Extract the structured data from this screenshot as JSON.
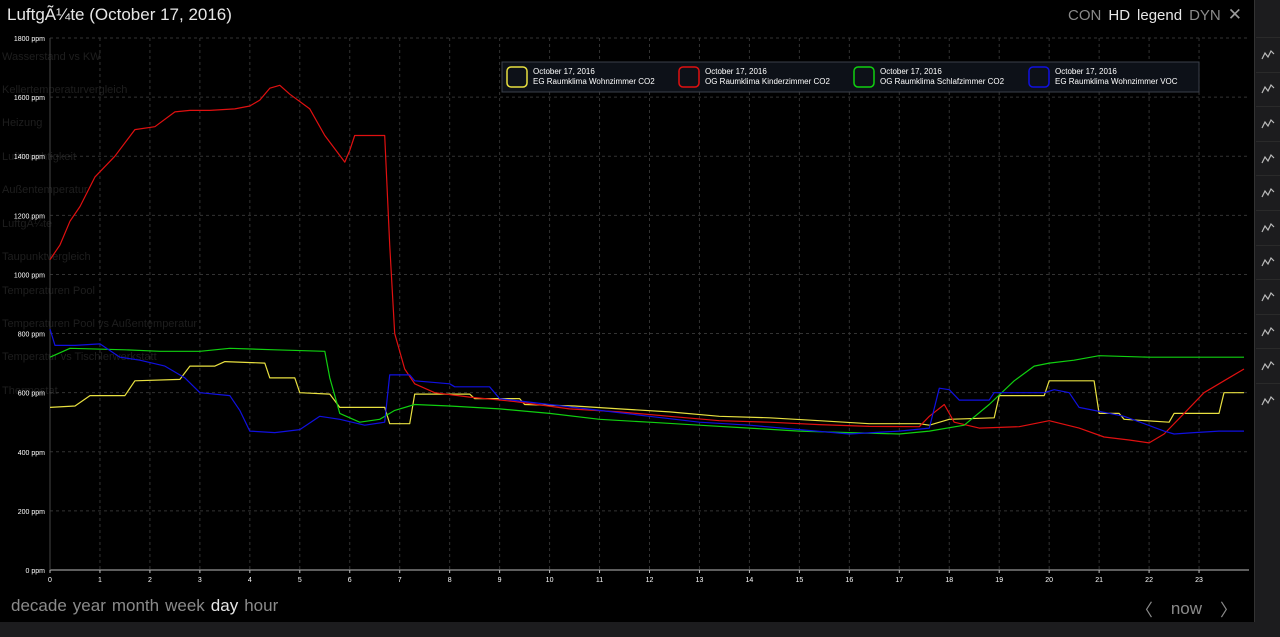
{
  "window": {
    "title": "LuftgÃ¼te (October 17, 2016)"
  },
  "toolbar": {
    "items": [
      {
        "label": "CON",
        "active": false
      },
      {
        "label": "HD",
        "active": true
      },
      {
        "label": "legend",
        "active": true
      },
      {
        "label": "DYN",
        "active": false
      }
    ],
    "close_label": "✕"
  },
  "ranges": {
    "items": [
      {
        "label": "decade",
        "active": false
      },
      {
        "label": "year",
        "active": false
      },
      {
        "label": "month",
        "active": false
      },
      {
        "label": "week",
        "active": false
      },
      {
        "label": "day",
        "active": true
      },
      {
        "label": "hour",
        "active": false
      }
    ]
  },
  "nav": {
    "prev": "〈",
    "now": "now",
    "next": "〉"
  },
  "background_list": [
    "Wasserstand vs KW",
    "Kellertemperaturvergleich",
    "Heizung",
    "Luftfeuchtigkeit",
    "Außentemperatur",
    "LuftgÃ¼te",
    "Taupunktvergleich",
    "Temperaturen Pool",
    "Temperaturen Pool vs Außentemperatur",
    "Temperatur vs Tischlerwerkstatt",
    "Thermostat"
  ],
  "side_icons": [
    "chart-icon",
    "chart-icon",
    "chart-icon",
    "chart-icon",
    "chart-icon",
    "chart-icon",
    "chart-icon",
    "chart-icon",
    "chart-icon",
    "chart-icon",
    "chart-icon"
  ],
  "colors": {
    "background": "#000000",
    "grid": "#333333",
    "axis_text": "#ffffff",
    "yellow": "#e8e040",
    "red": "#e01010",
    "green": "#10d010",
    "blue": "#1010e0"
  },
  "chart_data": {
    "type": "line",
    "xlabel": "",
    "ylabel": "",
    "xlim": [
      0,
      24
    ],
    "ylim": [
      0,
      1800
    ],
    "x_ticks": [
      0,
      1,
      2,
      3,
      4,
      5,
      6,
      7,
      8,
      9,
      10,
      11,
      12,
      13,
      14,
      15,
      16,
      17,
      18,
      19,
      20,
      21,
      22,
      23
    ],
    "y_ticks": [
      0,
      200,
      400,
      600,
      800,
      1000,
      1200,
      1400,
      1600,
      1800
    ],
    "y_tick_labels": [
      "0 ppm",
      "200 ppm",
      "400 ppm",
      "600 ppm",
      "800 ppm",
      "1000 ppm",
      "1200 ppm",
      "1400 ppm",
      "1600 ppm",
      "1800 ppm"
    ],
    "grid": true,
    "legend_position": "top-right",
    "series": [
      {
        "name": "EG Raumklima Wohnzimmer CO2",
        "date": "October 17, 2016",
        "color": "#e8e040",
        "points": [
          [
            0,
            550
          ],
          [
            0.5,
            555
          ],
          [
            0.8,
            590
          ],
          [
            1.5,
            590
          ],
          [
            1.7,
            640
          ],
          [
            2.6,
            645
          ],
          [
            2.8,
            690
          ],
          [
            3.3,
            690
          ],
          [
            3.5,
            705
          ],
          [
            4.3,
            700
          ],
          [
            4.4,
            650
          ],
          [
            4.9,
            650
          ],
          [
            5.0,
            600
          ],
          [
            5.6,
            595
          ],
          [
            5.8,
            550
          ],
          [
            6.7,
            550
          ],
          [
            6.8,
            495
          ],
          [
            7.2,
            495
          ],
          [
            7.3,
            595
          ],
          [
            8.4,
            595
          ],
          [
            8.5,
            580
          ],
          [
            9.4,
            580
          ],
          [
            9.5,
            560
          ],
          [
            10.5,
            555
          ],
          [
            11.4,
            545
          ],
          [
            12.4,
            535
          ],
          [
            13.4,
            520
          ],
          [
            14.4,
            515
          ],
          [
            15.4,
            505
          ],
          [
            16.4,
            495
          ],
          [
            17.4,
            495
          ],
          [
            17.6,
            490
          ],
          [
            18.0,
            510
          ],
          [
            18.9,
            515
          ],
          [
            19.0,
            590
          ],
          [
            19.9,
            590
          ],
          [
            20.0,
            640
          ],
          [
            20.9,
            640
          ],
          [
            21.0,
            530
          ],
          [
            21.4,
            530
          ],
          [
            21.5,
            510
          ],
          [
            22.4,
            500
          ],
          [
            22.5,
            530
          ],
          [
            23.4,
            530
          ],
          [
            23.5,
            600
          ],
          [
            23.9,
            600
          ]
        ]
      },
      {
        "name": "OG Raumklima Kinderzimmer CO2",
        "date": "October 17, 2016",
        "color": "#e01010",
        "points": [
          [
            0,
            1050
          ],
          [
            0.2,
            1100
          ],
          [
            0.4,
            1180
          ],
          [
            0.6,
            1230
          ],
          [
            0.9,
            1330
          ],
          [
            1.3,
            1400
          ],
          [
            1.7,
            1490
          ],
          [
            2.1,
            1500
          ],
          [
            2.5,
            1550
          ],
          [
            2.8,
            1555
          ],
          [
            3.2,
            1555
          ],
          [
            3.7,
            1560
          ],
          [
            4.0,
            1570
          ],
          [
            4.2,
            1590
          ],
          [
            4.4,
            1630
          ],
          [
            4.6,
            1640
          ],
          [
            4.8,
            1610
          ],
          [
            5.2,
            1560
          ],
          [
            5.5,
            1470
          ],
          [
            5.9,
            1380
          ],
          [
            6.0,
            1420
          ],
          [
            6.1,
            1470
          ],
          [
            6.7,
            1470
          ],
          [
            6.8,
            1100
          ],
          [
            6.9,
            800
          ],
          [
            7.1,
            680
          ],
          [
            7.3,
            630
          ],
          [
            7.7,
            600
          ],
          [
            8.4,
            585
          ],
          [
            9.3,
            570
          ],
          [
            10.4,
            545
          ],
          [
            11.4,
            535
          ],
          [
            12.4,
            520
          ],
          [
            13.4,
            505
          ],
          [
            14.4,
            500
          ],
          [
            15.4,
            492
          ],
          [
            16.4,
            486
          ],
          [
            17.4,
            485
          ],
          [
            17.6,
            520
          ],
          [
            17.9,
            560
          ],
          [
            18.1,
            500
          ],
          [
            18.6,
            480
          ],
          [
            19.4,
            485
          ],
          [
            20.0,
            505
          ],
          [
            20.6,
            480
          ],
          [
            21.1,
            450
          ],
          [
            21.6,
            440
          ],
          [
            22.0,
            430
          ],
          [
            22.3,
            460
          ],
          [
            22.7,
            530
          ],
          [
            23.1,
            600
          ],
          [
            23.5,
            640
          ],
          [
            23.9,
            680
          ]
        ]
      },
      {
        "name": "OG Raumklima Schlafzimmer CO2",
        "date": "October 17, 2016",
        "color": "#10d010",
        "points": [
          [
            0,
            720
          ],
          [
            0.4,
            750
          ],
          [
            1.5,
            745
          ],
          [
            2.2,
            740
          ],
          [
            3.0,
            740
          ],
          [
            3.6,
            750
          ],
          [
            4.5,
            745
          ],
          [
            5.5,
            740
          ],
          [
            5.6,
            650
          ],
          [
            5.8,
            530
          ],
          [
            6.2,
            500
          ],
          [
            6.6,
            510
          ],
          [
            6.9,
            540
          ],
          [
            7.3,
            560
          ],
          [
            8.0,
            555
          ],
          [
            9.0,
            545
          ],
          [
            10.0,
            530
          ],
          [
            11.0,
            510
          ],
          [
            12.0,
            500
          ],
          [
            13.0,
            490
          ],
          [
            14.0,
            480
          ],
          [
            15.0,
            470
          ],
          [
            16.0,
            465
          ],
          [
            17.0,
            460
          ],
          [
            17.6,
            470
          ],
          [
            18.3,
            490
          ],
          [
            18.8,
            560
          ],
          [
            19.3,
            640
          ],
          [
            19.7,
            690
          ],
          [
            20.0,
            700
          ],
          [
            20.5,
            710
          ],
          [
            21.0,
            725
          ],
          [
            22.0,
            720
          ],
          [
            23.0,
            720
          ],
          [
            23.9,
            720
          ]
        ]
      },
      {
        "name": "EG Raumklima Wohnzimmer VOC",
        "date": "October 17, 2016",
        "color": "#1010e0",
        "points": [
          [
            0,
            815
          ],
          [
            0.1,
            760
          ],
          [
            0.5,
            760
          ],
          [
            1.0,
            765
          ],
          [
            1.4,
            720
          ],
          [
            1.8,
            710
          ],
          [
            2.3,
            690
          ],
          [
            2.7,
            650
          ],
          [
            3.0,
            600
          ],
          [
            3.6,
            590
          ],
          [
            3.8,
            540
          ],
          [
            4.0,
            470
          ],
          [
            4.5,
            465
          ],
          [
            5.0,
            475
          ],
          [
            5.4,
            520
          ],
          [
            5.8,
            510
          ],
          [
            6.3,
            490
          ],
          [
            6.7,
            500
          ],
          [
            6.8,
            660
          ],
          [
            7.2,
            660
          ],
          [
            7.3,
            640
          ],
          [
            8.0,
            630
          ],
          [
            8.1,
            620
          ],
          [
            8.8,
            620
          ],
          [
            9.0,
            580
          ],
          [
            10.0,
            560
          ],
          [
            11.0,
            540
          ],
          [
            12.0,
            520
          ],
          [
            13.0,
            500
          ],
          [
            14.0,
            490
          ],
          [
            15.0,
            475
          ],
          [
            16.0,
            460
          ],
          [
            17.0,
            470
          ],
          [
            17.6,
            480
          ],
          [
            17.8,
            615
          ],
          [
            18.0,
            610
          ],
          [
            18.2,
            575
          ],
          [
            18.8,
            575
          ],
          [
            18.9,
            600
          ],
          [
            19.9,
            600
          ],
          [
            20.1,
            610
          ],
          [
            20.4,
            600
          ],
          [
            20.6,
            550
          ],
          [
            21.5,
            520
          ],
          [
            22.3,
            470
          ],
          [
            22.5,
            460
          ],
          [
            22.9,
            465
          ],
          [
            23.4,
            470
          ],
          [
            23.9,
            470
          ]
        ]
      }
    ]
  }
}
